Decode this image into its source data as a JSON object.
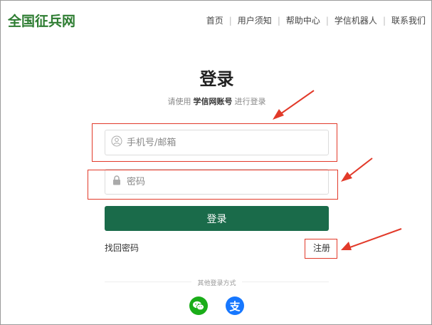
{
  "header": {
    "logo": "全国征兵网",
    "nav": [
      "首页",
      "用户须知",
      "帮助中心",
      "学信机器人",
      "联系我们"
    ]
  },
  "login": {
    "title": "登录",
    "subtitle_prefix": "请使用",
    "subtitle_account": "学信网账号",
    "subtitle_suffix": "进行登录",
    "phone_placeholder": "手机号/邮箱",
    "password_placeholder": "密码",
    "login_button": "登录",
    "forgot_password": "找回密码",
    "register": "注册"
  },
  "other_login": {
    "label": "其他登录方式",
    "alipay_glyph": "支"
  },
  "colors": {
    "brand_green": "#2e7d32",
    "button_green": "#1a6b4a",
    "annotation_red": "#e23a2a",
    "wechat_green": "#1aad19",
    "alipay_blue": "#1677ff"
  }
}
